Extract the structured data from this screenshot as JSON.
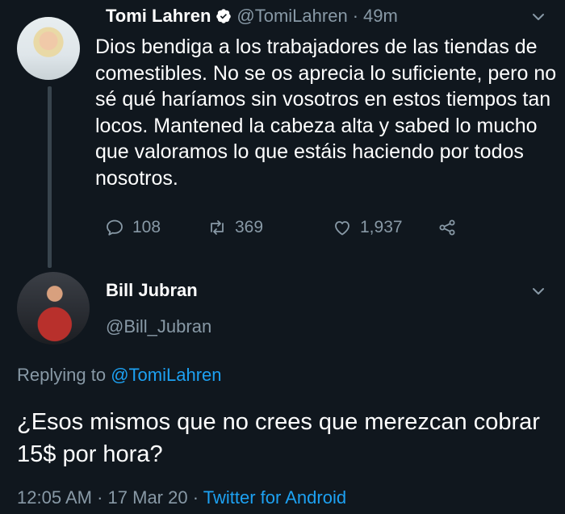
{
  "tweet": {
    "author_name": "Tomi Lahren",
    "author_handle": "@TomiLahren",
    "separator": "·",
    "time": "49m",
    "text": "Dios bendiga a los trabajadores de las tiendas de comestibles. No se os aprecia lo suficiente, pero no sé qué haríamos sin vosotros en estos tiempos tan locos. Mantened la cabeza alta y sabed lo mucho que valoramos lo que estáis haciendo por todos nosotros.",
    "actions": {
      "replies": "108",
      "retweets": "369",
      "likes": "1,937"
    },
    "icons": [
      "comment-icon",
      "retweet-icon",
      "heart-icon",
      "share-icon",
      "verified-badge-icon",
      "chevron-down-icon"
    ]
  },
  "reply": {
    "author_name": "Bill Jubran",
    "author_handle": "@Bill_Jubran",
    "replying_prefix": "Replying to",
    "replying_to": "@TomiLahren",
    "text": "¿Esos mismos que no crees que merezcan cobrar 15$ por hora?",
    "time": "12:05 AM",
    "date": "17 Mar 20",
    "separator": "·",
    "source": "Twitter for Android"
  },
  "colors": {
    "background": "#10171e",
    "text": "#ffffff",
    "muted": "#8899a6",
    "link": "#1da1f2",
    "thread_line": "#38444d"
  }
}
